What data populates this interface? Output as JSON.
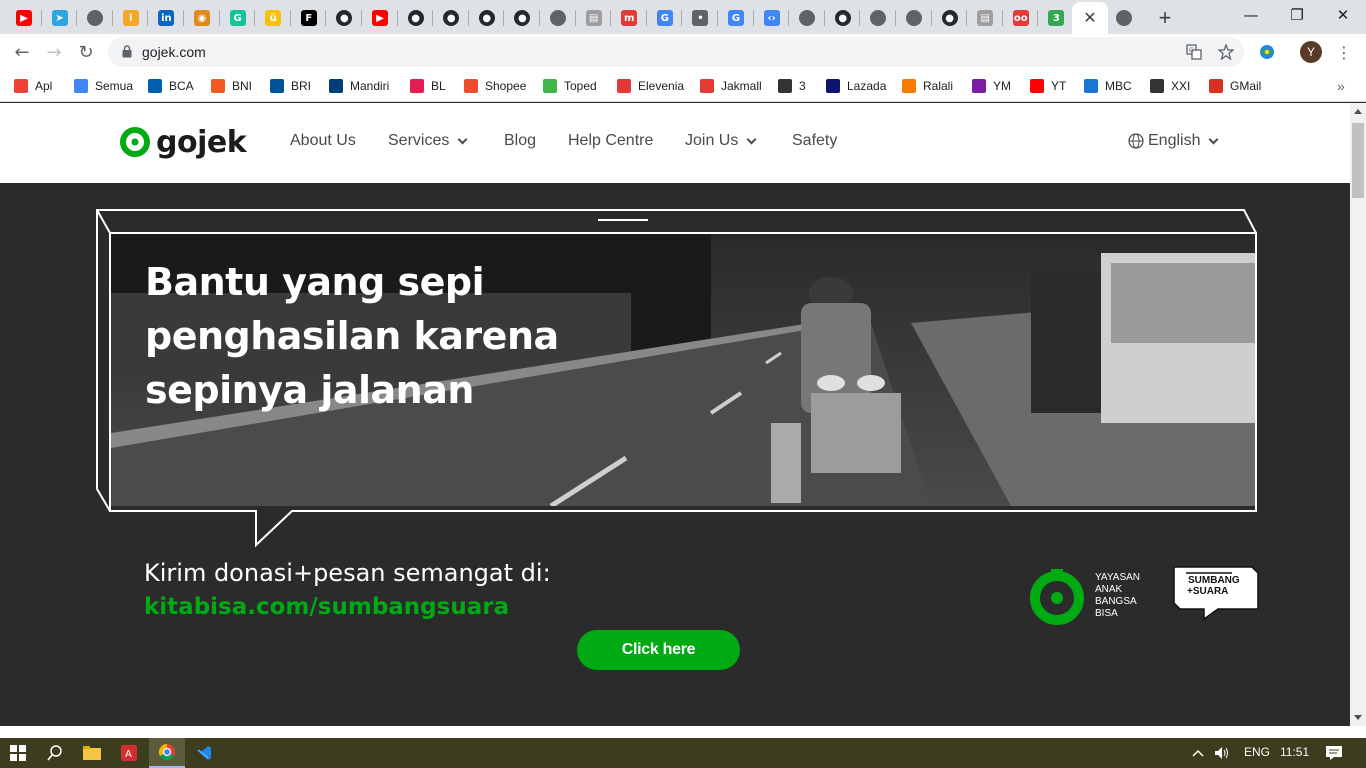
{
  "browser": {
    "tabs": [
      {
        "icon": "youtube-icon",
        "color": "#ff0000"
      },
      {
        "icon": "telegram-icon",
        "color": "#2ca5e0"
      },
      {
        "icon": "globe-icon",
        "color": "#5f6368"
      },
      {
        "icon": "info-icon",
        "color": "#f5a623"
      },
      {
        "icon": "linkedin-icon",
        "color": "#0a66c2"
      },
      {
        "icon": "tokopedia-icon",
        "color": "#e08a1e"
      },
      {
        "icon": "grammarly-icon",
        "color": "#15c39a"
      },
      {
        "icon": "u-icon",
        "color": "#f4c20d"
      },
      {
        "icon": "f-icon",
        "color": "#000000"
      },
      {
        "icon": "github-icon",
        "color": "#24292e"
      },
      {
        "icon": "youtube-icon",
        "color": "#ff0000"
      },
      {
        "icon": "github-icon",
        "color": "#24292e"
      },
      {
        "icon": "github-icon",
        "color": "#24292e"
      },
      {
        "icon": "github-icon",
        "color": "#24292e"
      },
      {
        "icon": "github-icon",
        "color": "#24292e"
      },
      {
        "icon": "globe-icon",
        "color": "#5f6368"
      },
      {
        "icon": "document-icon",
        "color": "#9e9e9e"
      },
      {
        "icon": "m-icon",
        "color": "#e53935"
      },
      {
        "icon": "google-icon",
        "color": "#4285f4"
      },
      {
        "icon": "drop-icon",
        "color": "#5f6368"
      },
      {
        "icon": "google-icon",
        "color": "#4285f4"
      },
      {
        "icon": "code-icon",
        "color": "#4285f4"
      },
      {
        "icon": "globe-icon",
        "color": "#5f6368"
      },
      {
        "icon": "github-icon",
        "color": "#24292e"
      },
      {
        "icon": "globe-icon",
        "color": "#5f6368"
      },
      {
        "icon": "globe-icon",
        "color": "#5f6368"
      },
      {
        "icon": "github-icon",
        "color": "#24292e"
      },
      {
        "icon": "document-icon",
        "color": "#9e9e9e"
      },
      {
        "icon": "oo-icon",
        "color": "#e53935"
      },
      {
        "icon": "badge-icon",
        "color": "#34a853"
      }
    ],
    "active_tab_close": "✕",
    "new_tab": "+",
    "url": "gojek.com",
    "profile_initial": "Y"
  },
  "bookmarks": [
    {
      "label": "Apl",
      "icon": "apps-grid-icon",
      "color": "#ea4335"
    },
    {
      "label": "Semua",
      "icon": "google-icon",
      "color": "#4285f4"
    },
    {
      "label": "BCA",
      "icon": "bca-icon",
      "color": "#0060af"
    },
    {
      "label": "BNI",
      "icon": "bni-icon",
      "color": "#f15a22"
    },
    {
      "label": "BRI",
      "icon": "bri-icon",
      "color": "#00529c"
    },
    {
      "label": "Mandiri",
      "icon": "mandiri-icon",
      "color": "#003d79"
    },
    {
      "label": "BL",
      "icon": "bukalapak-icon",
      "color": "#e31e52"
    },
    {
      "label": "Shopee",
      "icon": "shopee-icon",
      "color": "#ee4d2d"
    },
    {
      "label": "Toped",
      "icon": "tokopedia-icon",
      "color": "#42b549"
    },
    {
      "label": "Elevenia",
      "icon": "elevenia-icon",
      "color": "#e53935"
    },
    {
      "label": "Jakmall",
      "icon": "jakmall-icon",
      "color": "#e53935"
    },
    {
      "label": "3",
      "icon": "three-icon",
      "color": "#333333"
    },
    {
      "label": "Lazada",
      "icon": "lazada-icon",
      "color": "#0f146d"
    },
    {
      "label": "Ralali",
      "icon": "ralali-icon",
      "color": "#f57c00"
    },
    {
      "label": "YM",
      "icon": "ym-icon",
      "color": "#7b1fa2"
    },
    {
      "label": "YT",
      "icon": "youtube-icon",
      "color": "#ff0000"
    },
    {
      "label": "MBC",
      "icon": "mbc-icon",
      "color": "#1976d2"
    },
    {
      "label": "XXI",
      "icon": "xxi-icon",
      "color": "#333333"
    },
    {
      "label": "GMail",
      "icon": "gmail-icon",
      "color": "#d93025"
    }
  ],
  "site": {
    "logo_text": "gojek",
    "nav": [
      {
        "label": "About Us",
        "caret": false
      },
      {
        "label": "Services",
        "caret": true
      },
      {
        "label": "Blog",
        "caret": false
      },
      {
        "label": "Help Centre",
        "caret": false
      },
      {
        "label": "Join Us",
        "caret": true
      },
      {
        "label": "Safety",
        "caret": false
      }
    ],
    "language": "English"
  },
  "hero": {
    "title_lines": [
      "Bantu yang sepi",
      "penghasilan karena",
      "sepinya jalanan"
    ],
    "donate_text": "Kirim donasi+pesan semangat di:",
    "donate_link": "kitabisa.com/sumbangsuara",
    "cta_label": "Click here",
    "yab_lines": [
      "YAYASAN",
      "ANAK",
      "BANGSA",
      "BISA"
    ],
    "sumbang_lines": [
      "SUMBANG",
      "+SUARA"
    ]
  },
  "colors": {
    "brand_green": "#00aa13",
    "hero_bg": "#2b2b2b"
  },
  "taskbar": {
    "language": "ENG",
    "time": "11:51"
  }
}
